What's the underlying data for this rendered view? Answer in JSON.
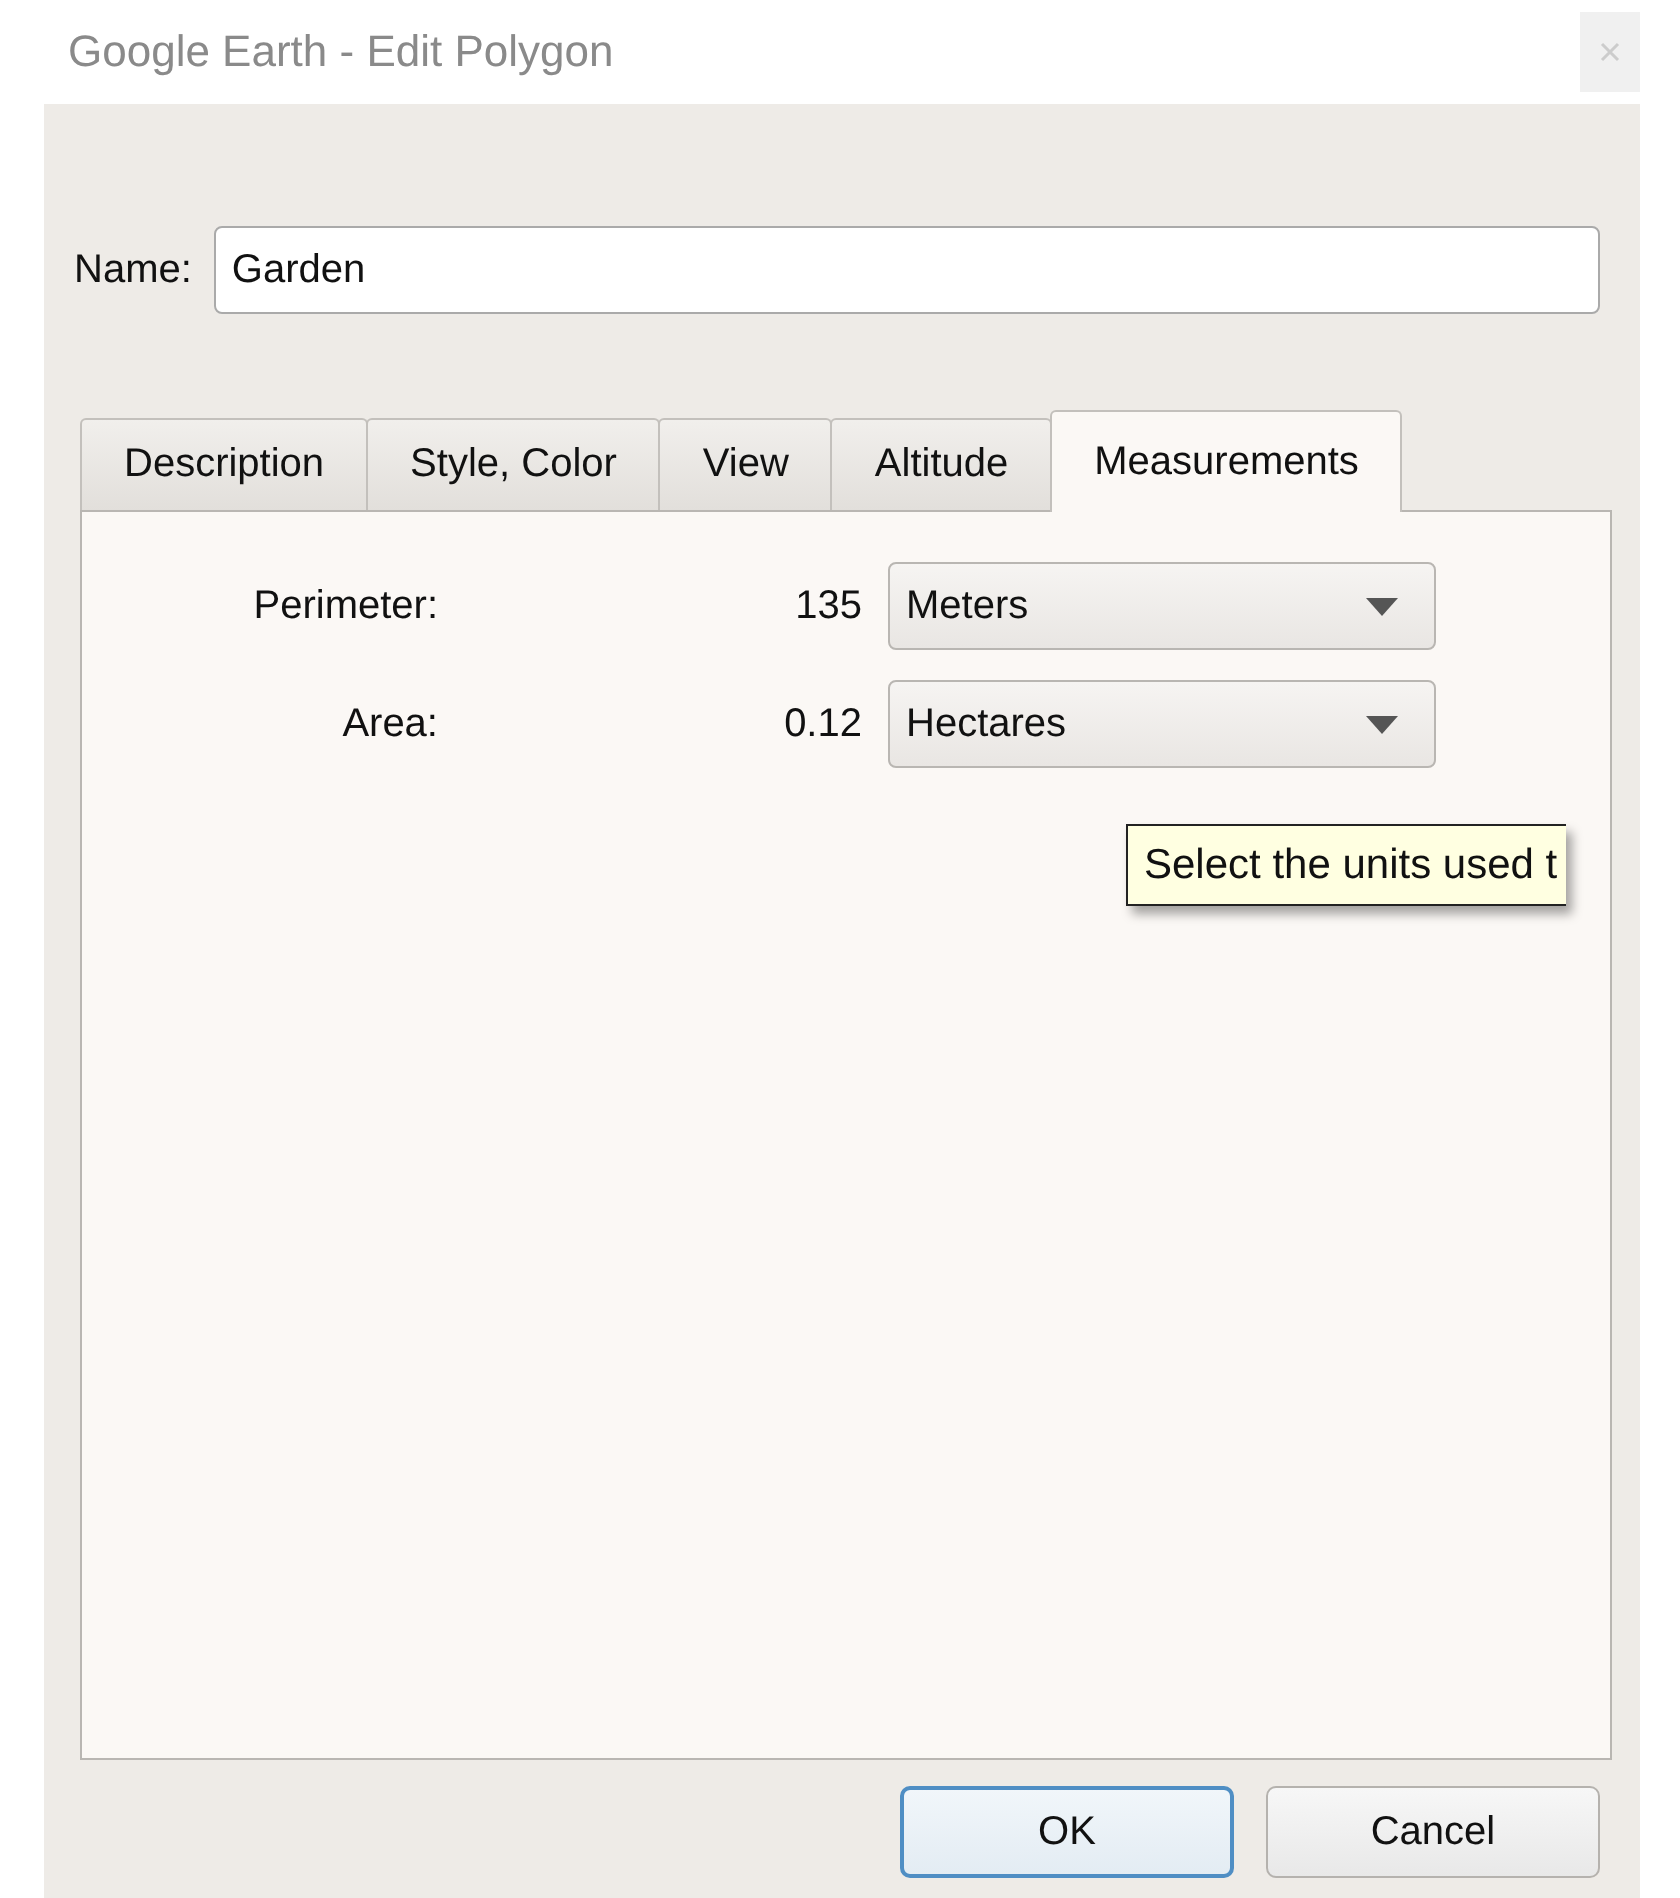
{
  "window": {
    "title": "Google Earth - Edit Polygon"
  },
  "name_field": {
    "label": "Name:",
    "value": "Garden"
  },
  "tabs": [
    {
      "label": "Description",
      "selected": false
    },
    {
      "label": "Style, Color",
      "selected": false
    },
    {
      "label": "View",
      "selected": false
    },
    {
      "label": "Altitude",
      "selected": false
    },
    {
      "label": "Measurements",
      "selected": true
    }
  ],
  "measurements": [
    {
      "label": "Perimeter:",
      "value": "135",
      "unit": "Meters"
    },
    {
      "label": "Area:",
      "value": "0.12",
      "unit": "Hectares"
    }
  ],
  "tooltip": {
    "text": "Select the units used t"
  },
  "buttons": [
    {
      "label": "OK",
      "default": true
    },
    {
      "label": "Cancel",
      "default": false
    }
  ]
}
